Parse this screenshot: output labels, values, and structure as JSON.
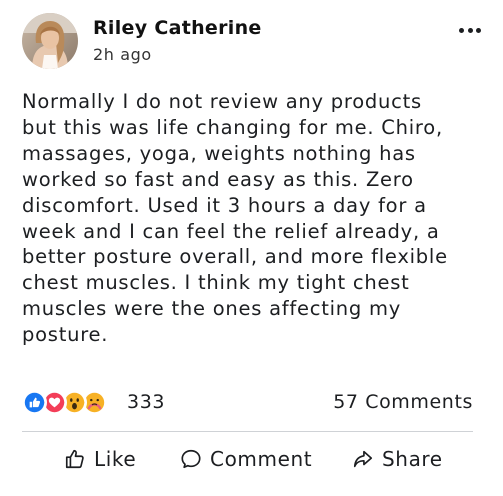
{
  "post": {
    "author": "Riley Catherine",
    "time": "2h ago",
    "text": "Normally I do not review any products\nbut this was life changing for me. Chiro,\nmassages, yoga, weights nothing has\nworked so fast and easy as this. Zero\ndiscomfort. Used it 3 hours a day for a\nweek and I can feel the relief already, a\nbetter posture overall, and more flexible\nchest muscles. I think my tight chest\nmuscles were the ones affecting my\nposture."
  },
  "reactions": {
    "icons": [
      "like-icon",
      "love-icon",
      "wow-icon",
      "care-icon"
    ],
    "count": "333",
    "comments": "57 Comments"
  },
  "actions": {
    "like": "Like",
    "comment": "Comment",
    "share": "Share"
  },
  "colors": {
    "like_blue": "#1877f2",
    "love_red": "#f33e58",
    "wow_yellow": "#f7b125",
    "divider": "#cfd2d6"
  }
}
